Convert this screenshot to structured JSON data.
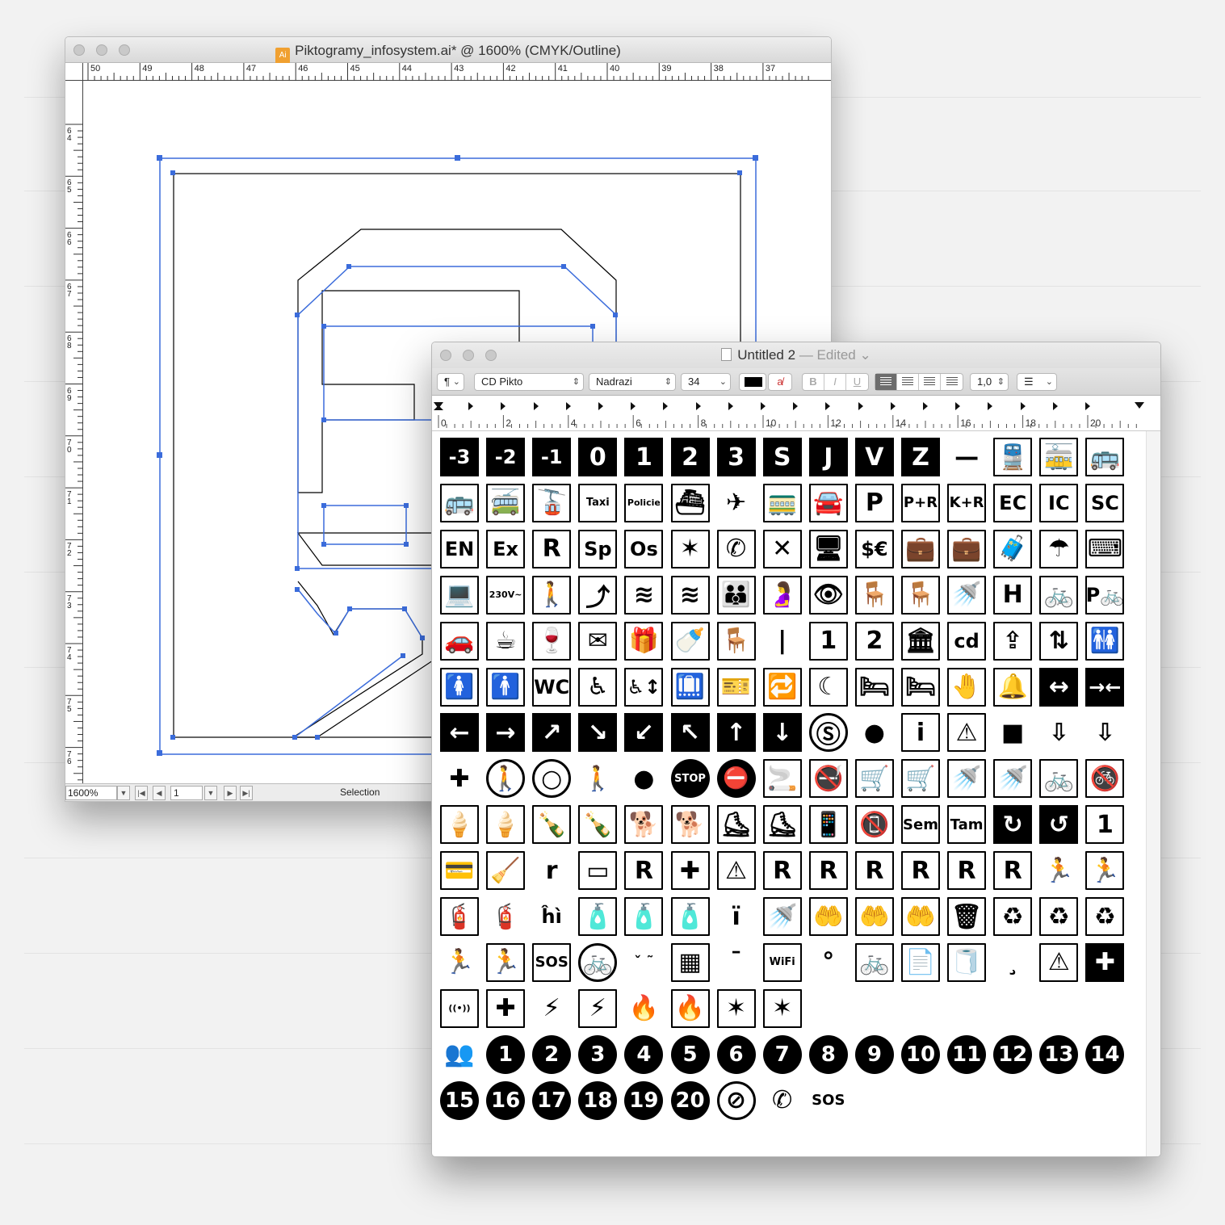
{
  "illustrator": {
    "title": "Piktogramy_infosystem.ai* @ 1600% (CMYK/Outline)",
    "file_icon": "Ai",
    "ruler_top": [
      "50",
      "49",
      "48",
      "47",
      "46",
      "45",
      "44",
      "43",
      "42",
      "41",
      "40",
      "39",
      "38",
      "37"
    ],
    "ruler_left": [
      "64",
      "65",
      "66",
      "67",
      "68",
      "69",
      "70",
      "71",
      "72",
      "73",
      "74",
      "75",
      "76"
    ],
    "zoom": "1600%",
    "page": "1",
    "status_label": "Selection"
  },
  "textedit": {
    "title": "Untitled 2",
    "edited": "— Edited",
    "toolbar": {
      "paragraph": "¶",
      "font_family": "CD Pikto",
      "font_style": "Nadrazi",
      "font_size": "34",
      "bold": "B",
      "italic": "I",
      "underline": "U",
      "line_spacing": "1,0",
      "list": "☰"
    },
    "ruler": [
      "0",
      "2",
      "4",
      "6",
      "8",
      "10",
      "12",
      "14",
      "16",
      "18",
      "20"
    ]
  },
  "glyph_rows": [
    [
      [
        "-3",
        "inv"
      ],
      [
        "-2",
        "inv"
      ],
      [
        "-1",
        "inv"
      ],
      [
        "0",
        "inv"
      ],
      [
        "1",
        "inv"
      ],
      [
        "2",
        "inv"
      ],
      [
        "3",
        "inv"
      ],
      [
        "S",
        "inv"
      ],
      [
        "J",
        "inv"
      ],
      [
        "V",
        "inv"
      ],
      [
        "Z",
        "inv"
      ],
      [
        "—",
        "plain"
      ],
      [
        "🚆",
        "box"
      ],
      [
        "🚋",
        "box"
      ],
      [
        "🚌",
        "box"
      ]
    ],
    [
      [
        "🚌",
        "box"
      ],
      [
        "🚎",
        "box"
      ],
      [
        "🚡",
        "box"
      ],
      [
        "Taxi",
        "box"
      ],
      [
        "Policie",
        "box"
      ],
      [
        "⛴",
        "box"
      ],
      [
        "✈",
        "plain"
      ],
      [
        "🚃",
        "box"
      ],
      [
        "🚘",
        "box"
      ],
      [
        "P",
        "box"
      ],
      [
        "P+R",
        "box"
      ],
      [
        "K+R",
        "box"
      ],
      [
        "EC",
        "box"
      ],
      [
        "IC",
        "box"
      ],
      [
        "SC",
        "box"
      ]
    ],
    [
      [
        "EN",
        "box"
      ],
      [
        "Ex",
        "box"
      ],
      [
        "R",
        "box"
      ],
      [
        "Sp",
        "box"
      ],
      [
        "Os",
        "box"
      ],
      [
        "✶",
        "box"
      ],
      [
        "✆",
        "box"
      ],
      [
        "✕",
        "box"
      ],
      [
        "🖥",
        "box"
      ],
      [
        "$€",
        "box"
      ],
      [
        "💼",
        "box"
      ],
      [
        "💼",
        "box"
      ],
      [
        "🧳",
        "box"
      ],
      [
        "☂",
        "box"
      ],
      [
        "⌨",
        "box"
      ]
    ],
    [
      [
        "💻",
        "box"
      ],
      [
        "230V~",
        "box"
      ],
      [
        "🚶",
        "box"
      ],
      [
        "⤴",
        "box"
      ],
      [
        "≋",
        "box"
      ],
      [
        "≋",
        "box"
      ],
      [
        "👪",
        "box"
      ],
      [
        "🤰",
        "box"
      ],
      [
        "👁",
        "box"
      ],
      [
        "🪑",
        "box"
      ],
      [
        "🪑",
        "box"
      ],
      [
        "🚿",
        "box"
      ],
      [
        "H",
        "box"
      ],
      [
        "🚲",
        "box"
      ],
      [
        "P🚲",
        "box"
      ]
    ],
    [
      [
        "🚗",
        "box"
      ],
      [
        "☕",
        "box"
      ],
      [
        "🍷",
        "box"
      ],
      [
        "✉",
        "box"
      ],
      [
        "🎁",
        "box"
      ],
      [
        "🍼",
        "box"
      ],
      [
        "🪑",
        "box"
      ],
      [
        "|",
        "plain"
      ],
      [
        "1",
        "box"
      ],
      [
        "2",
        "box"
      ],
      [
        "🏛",
        "box"
      ],
      [
        "cd",
        "box"
      ],
      [
        "⇪",
        "box"
      ],
      [
        "⇅",
        "box"
      ],
      [
        "🚻",
        "box"
      ]
    ],
    [
      [
        "🚺",
        "box"
      ],
      [
        "🚹",
        "box"
      ],
      [
        "WC",
        "box"
      ],
      [
        "♿",
        "box"
      ],
      [
        "♿↕",
        "box"
      ],
      [
        "🛄",
        "box"
      ],
      [
        "🎫",
        "box"
      ],
      [
        "🔁",
        "box"
      ],
      [
        "☾",
        "box"
      ],
      [
        "🛏",
        "box"
      ],
      [
        "🛏",
        "box"
      ],
      [
        "🤚",
        "box"
      ],
      [
        "🔔",
        "box"
      ],
      [
        "↔",
        "inv"
      ],
      [
        "→←",
        "inv"
      ]
    ],
    [
      [
        "←",
        "inv"
      ],
      [
        "→",
        "inv"
      ],
      [
        "↗",
        "inv"
      ],
      [
        "↘",
        "inv"
      ],
      [
        "↙",
        "inv"
      ],
      [
        "↖",
        "inv"
      ],
      [
        "↑",
        "inv"
      ],
      [
        "↓",
        "inv"
      ],
      [
        "Ⓢ",
        "ring"
      ],
      [
        "●",
        "plain"
      ],
      [
        "i",
        "box"
      ],
      [
        "⚠",
        "box"
      ],
      [
        "■",
        "plain"
      ],
      [
        "⇩",
        "plain"
      ],
      [
        "⇩",
        "plain"
      ]
    ],
    [
      [
        "✚",
        "plain"
      ],
      [
        "🚶",
        "ring"
      ],
      [
        "○",
        "ring"
      ],
      [
        "🚶",
        "plain"
      ],
      [
        "●",
        "plain"
      ],
      [
        "STOP",
        "circle"
      ],
      [
        "⛔",
        "circle"
      ],
      [
        "🚬",
        "box"
      ],
      [
        "🚭",
        "box"
      ],
      [
        "🛒",
        "box"
      ],
      [
        "🛒",
        "box"
      ],
      [
        "🚿",
        "box"
      ],
      [
        "🚿",
        "box"
      ],
      [
        "🚲",
        "box"
      ],
      [
        "🚳",
        "box"
      ]
    ],
    [
      [
        "🍦",
        "box"
      ],
      [
        "🍦",
        "box"
      ],
      [
        "🍾",
        "box"
      ],
      [
        "🍾",
        "box"
      ],
      [
        "🐕",
        "box"
      ],
      [
        "🐕",
        "box"
      ],
      [
        "⛸",
        "box"
      ],
      [
        "⛸",
        "box"
      ],
      [
        "📱",
        "box"
      ],
      [
        "📵",
        "box"
      ],
      [
        "Sem",
        "box"
      ],
      [
        "Tam",
        "box"
      ],
      [
        "↻",
        "inv"
      ],
      [
        "↺",
        "inv"
      ],
      [
        "1",
        "box"
      ]
    ],
    [
      [
        "💳",
        "box"
      ],
      [
        "🧹",
        "box"
      ],
      [
        "r",
        "plain"
      ],
      [
        "▭",
        "box"
      ],
      [
        "R",
        "box"
      ],
      [
        "✚",
        "box"
      ],
      [
        "⚠",
        "box"
      ],
      [
        "R",
        "box"
      ],
      [
        "R",
        "box"
      ],
      [
        "R",
        "box"
      ],
      [
        "R",
        "box"
      ],
      [
        "R",
        "box"
      ],
      [
        "R",
        "box"
      ],
      [
        "🏃",
        "plain"
      ],
      [
        "🏃",
        "box"
      ]
    ],
    [
      [
        "🧯",
        "box"
      ],
      [
        "🧯",
        "plain"
      ],
      [
        "ĥì",
        "plain"
      ],
      [
        "🧴",
        "box"
      ],
      [
        "🧴",
        "box"
      ],
      [
        "🧴",
        "box"
      ],
      [
        "ï",
        "plain"
      ],
      [
        "🚿",
        "box"
      ],
      [
        "🤲",
        "box"
      ],
      [
        "🤲",
        "box"
      ],
      [
        "🤲",
        "box"
      ],
      [
        "🗑",
        "box"
      ],
      [
        "♻",
        "box"
      ],
      [
        "♻",
        "box"
      ],
      [
        "♻",
        "box"
      ]
    ],
    [
      [
        "🏃",
        "plain"
      ],
      [
        "🏃",
        "box"
      ],
      [
        "SOS",
        "box"
      ],
      [
        "🚲",
        "ring"
      ],
      [
        "ˇ ˜",
        "plain"
      ],
      [
        "▦",
        "box"
      ],
      [
        "¯",
        "plain"
      ],
      [
        "WiFi",
        "box"
      ],
      [
        "°",
        "plain"
      ],
      [
        "🚲",
        "box"
      ],
      [
        "📄",
        "box"
      ],
      [
        "🧻",
        "box"
      ],
      [
        "¸",
        "plain"
      ],
      [
        "⚠",
        "box"
      ],
      [
        "✚",
        "inv"
      ]
    ],
    [
      [
        "((•))",
        "box"
      ],
      [
        "✚",
        "box"
      ],
      [
        "⚡",
        "plain"
      ],
      [
        "⚡",
        "box"
      ],
      [
        "🔥",
        "plain"
      ],
      [
        "🔥",
        "box"
      ],
      [
        "✶",
        "box"
      ],
      [
        "✶",
        "box"
      ]
    ],
    [
      [
        "👥",
        "plain"
      ],
      [
        "1",
        "circle"
      ],
      [
        "2",
        "circle"
      ],
      [
        "3",
        "circle"
      ],
      [
        "4",
        "circle"
      ],
      [
        "5",
        "circle"
      ],
      [
        "6",
        "circle"
      ],
      [
        "7",
        "circle"
      ],
      [
        "8",
        "circle"
      ],
      [
        "9",
        "circle"
      ],
      [
        "10",
        "circle"
      ],
      [
        "11",
        "circle"
      ],
      [
        "12",
        "circle"
      ],
      [
        "13",
        "circle"
      ],
      [
        "14",
        "circle"
      ]
    ],
    [
      [
        "15",
        "circle"
      ],
      [
        "16",
        "circle"
      ],
      [
        "17",
        "circle"
      ],
      [
        "18",
        "circle"
      ],
      [
        "19",
        "circle"
      ],
      [
        "20",
        "circle"
      ],
      [
        "⊘",
        "ring"
      ],
      [
        "✆",
        "plain"
      ],
      [
        "SOS",
        "plain"
      ]
    ]
  ],
  "colors": {
    "selection_blue": "#3b6cdb",
    "ink": "#000000"
  }
}
